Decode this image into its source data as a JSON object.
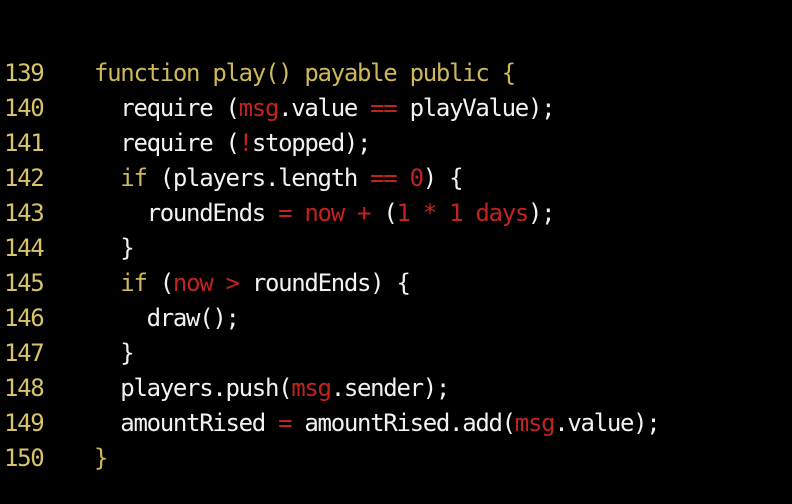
{
  "colors": {
    "background": "#000000",
    "line_number": "#d7c46a",
    "keyword": "#cdb85a",
    "plain": "#f2f2f2",
    "special": "#c1231e"
  },
  "lines": [
    {
      "num": "139",
      "segments": [
        {
          "t": "function play() payable public {",
          "c": "keyword"
        }
      ]
    },
    {
      "num": "140",
      "segments": [
        {
          "t": "  require (",
          "c": "plain"
        },
        {
          "t": "msg",
          "c": "special"
        },
        {
          "t": ".value ",
          "c": "plain"
        },
        {
          "t": "==",
          "c": "special"
        },
        {
          "t": " playValue);",
          "c": "plain"
        }
      ]
    },
    {
      "num": "141",
      "segments": [
        {
          "t": "  require (",
          "c": "plain"
        },
        {
          "t": "!",
          "c": "special"
        },
        {
          "t": "stopped);",
          "c": "plain"
        }
      ]
    },
    {
      "num": "142",
      "segments": [
        {
          "t": "  if",
          "c": "keyword"
        },
        {
          "t": " (players.length ",
          "c": "plain"
        },
        {
          "t": "==",
          "c": "special"
        },
        {
          "t": " ",
          "c": "plain"
        },
        {
          "t": "0",
          "c": "special"
        },
        {
          "t": ") {",
          "c": "plain"
        }
      ]
    },
    {
      "num": "143",
      "segments": [
        {
          "t": "    roundEnds ",
          "c": "plain"
        },
        {
          "t": "=",
          "c": "special"
        },
        {
          "t": " ",
          "c": "plain"
        },
        {
          "t": "now",
          "c": "special"
        },
        {
          "t": " ",
          "c": "plain"
        },
        {
          "t": "+",
          "c": "special"
        },
        {
          "t": " (",
          "c": "plain"
        },
        {
          "t": "1",
          "c": "special"
        },
        {
          "t": " ",
          "c": "plain"
        },
        {
          "t": "*",
          "c": "special"
        },
        {
          "t": " ",
          "c": "plain"
        },
        {
          "t": "1 days",
          "c": "special"
        },
        {
          "t": ");",
          "c": "plain"
        }
      ]
    },
    {
      "num": "144",
      "segments": [
        {
          "t": "  }",
          "c": "plain"
        }
      ]
    },
    {
      "num": "145",
      "segments": [
        {
          "t": "  if",
          "c": "keyword"
        },
        {
          "t": " (",
          "c": "plain"
        },
        {
          "t": "now",
          "c": "special"
        },
        {
          "t": " ",
          "c": "plain"
        },
        {
          "t": ">",
          "c": "special"
        },
        {
          "t": " roundEnds) {",
          "c": "plain"
        }
      ]
    },
    {
      "num": "146",
      "segments": [
        {
          "t": "    draw();",
          "c": "plain"
        }
      ]
    },
    {
      "num": "147",
      "segments": [
        {
          "t": "  }",
          "c": "plain"
        }
      ]
    },
    {
      "num": "148",
      "segments": [
        {
          "t": "  players.push(",
          "c": "plain"
        },
        {
          "t": "msg",
          "c": "special"
        },
        {
          "t": ".sender);",
          "c": "plain"
        }
      ]
    },
    {
      "num": "149",
      "segments": [
        {
          "t": "  amountRised ",
          "c": "plain"
        },
        {
          "t": "=",
          "c": "special"
        },
        {
          "t": " amountRised.add(",
          "c": "plain"
        },
        {
          "t": "msg",
          "c": "special"
        },
        {
          "t": ".value);",
          "c": "plain"
        }
      ]
    },
    {
      "num": "150",
      "segments": [
        {
          "t": "}",
          "c": "keyword"
        }
      ]
    }
  ]
}
